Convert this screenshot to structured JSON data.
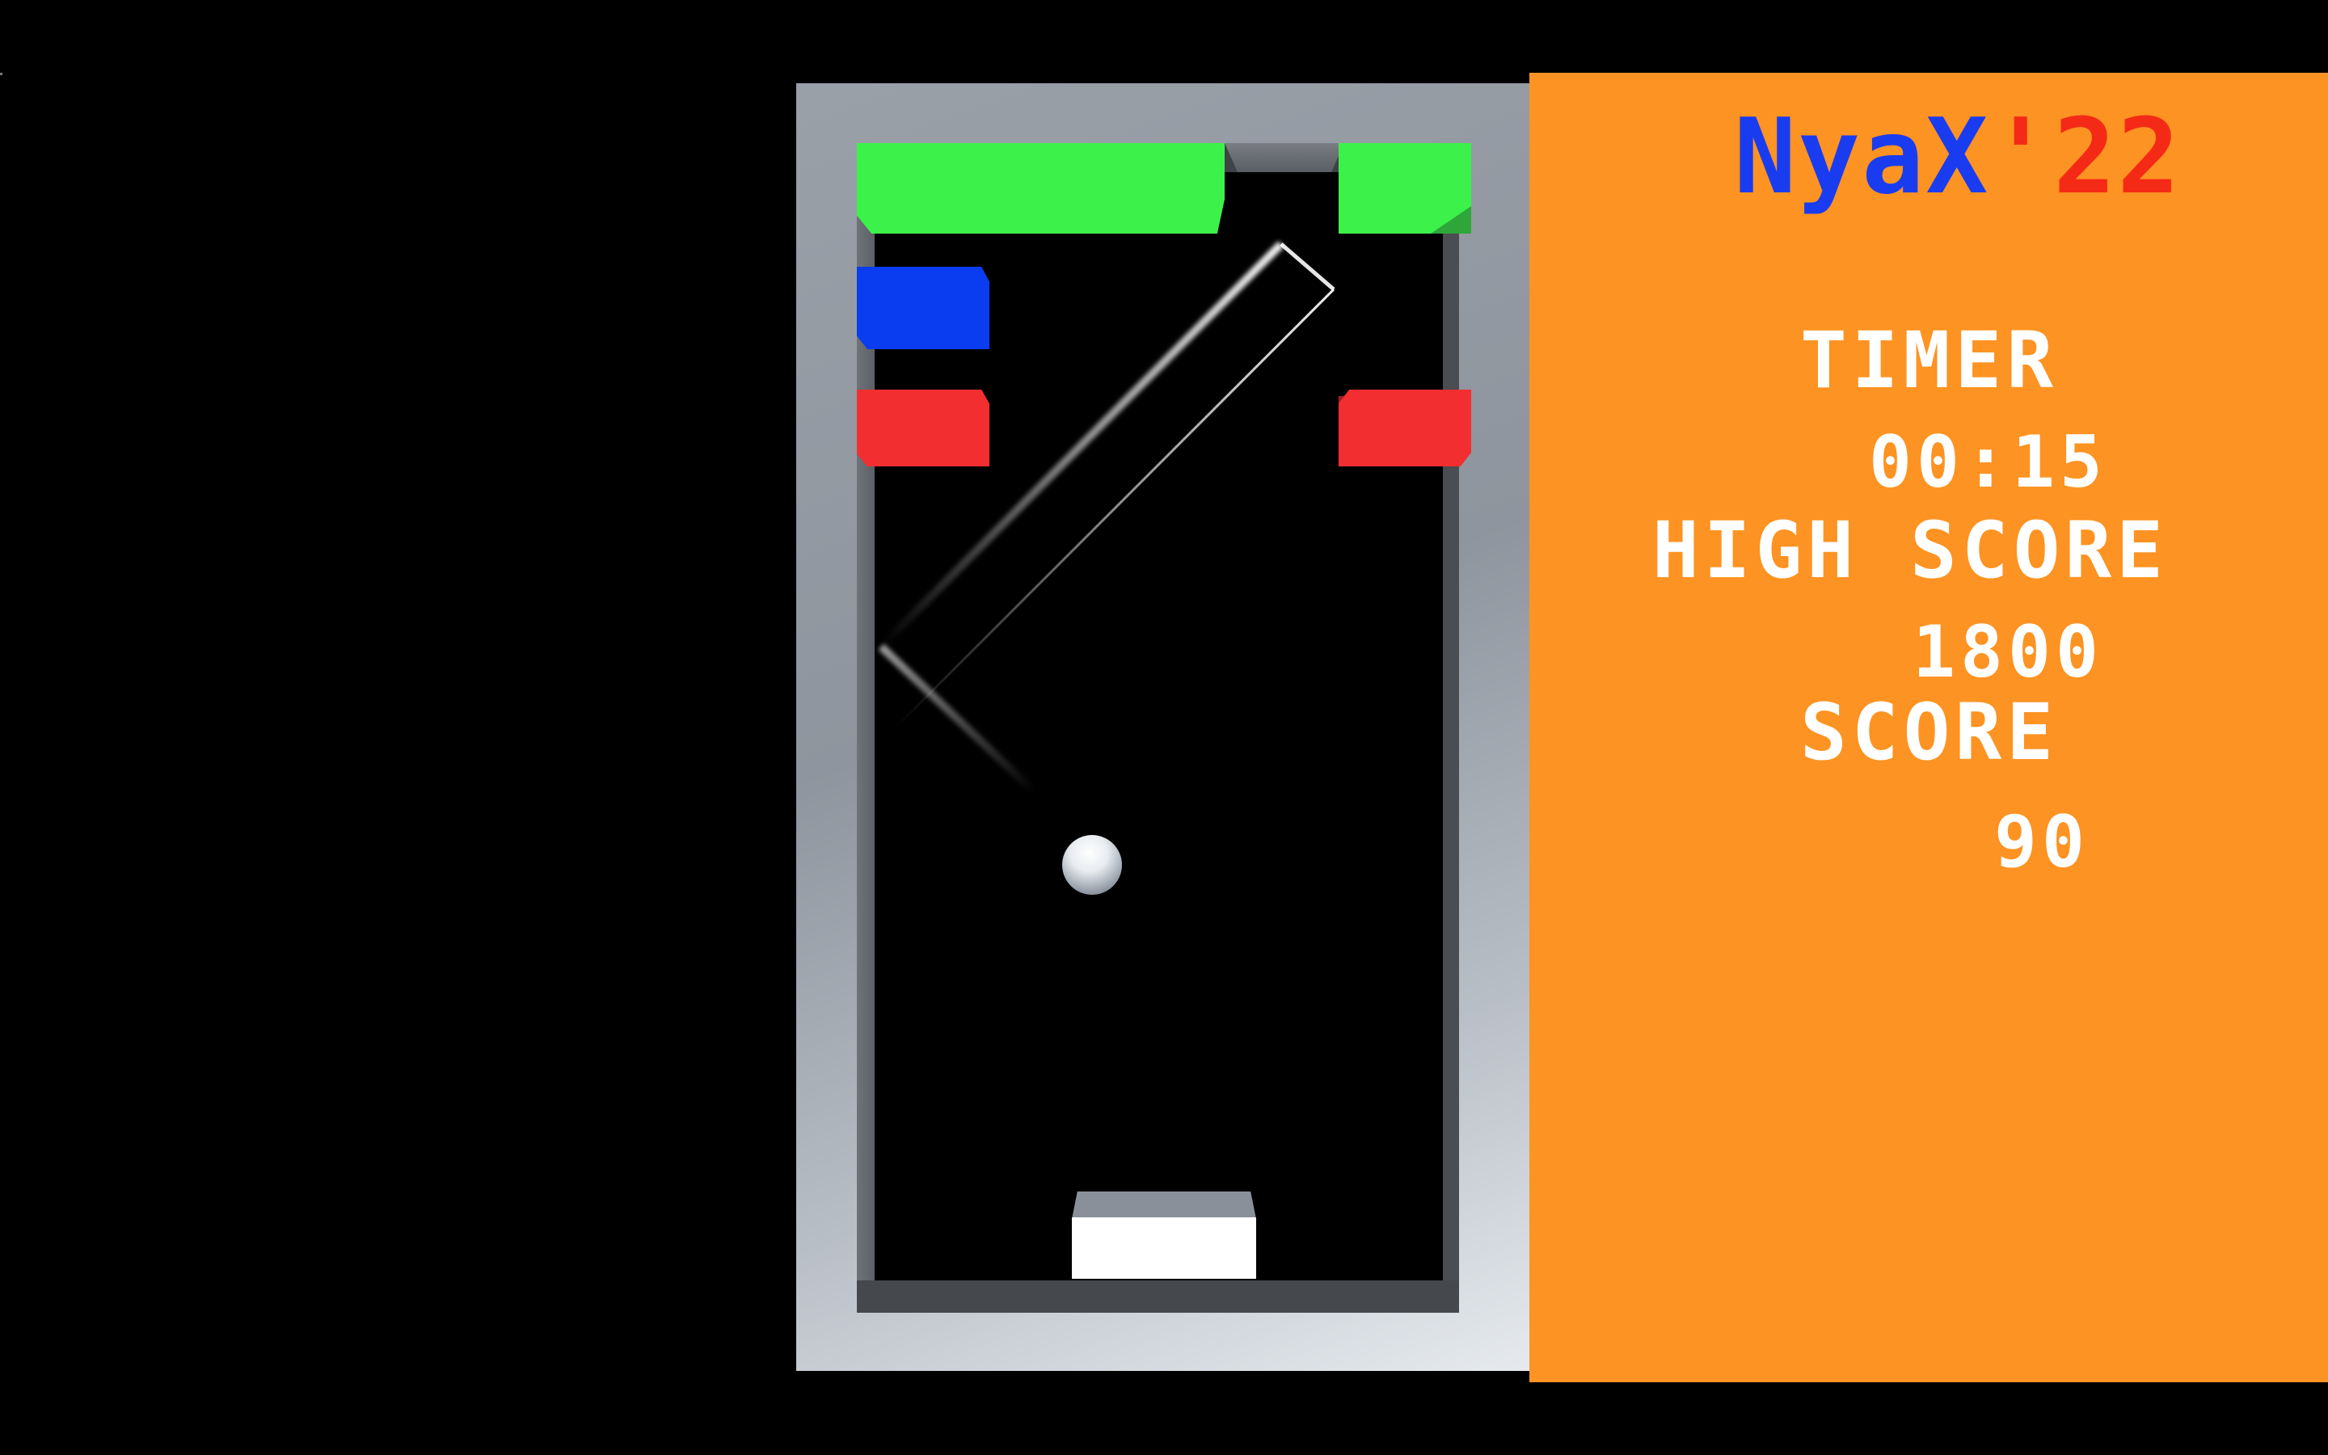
{
  "game": {
    "title_part1": "NyaX",
    "title_part2": "'22"
  },
  "hud": {
    "timer_label": "TIMER",
    "timer_value": "00:15",
    "high_score_label": "HIGH SCORE",
    "high_score_value": "1800",
    "score_label": "SCORE",
    "score_value": "90"
  },
  "colors": {
    "panel": "#fd9322",
    "title_blue": "#1a3cf0",
    "title_red": "#f52a16",
    "brick_green": "#3cf24a",
    "brick_blue": "#0a3cf0",
    "brick_red": "#f22e31"
  }
}
